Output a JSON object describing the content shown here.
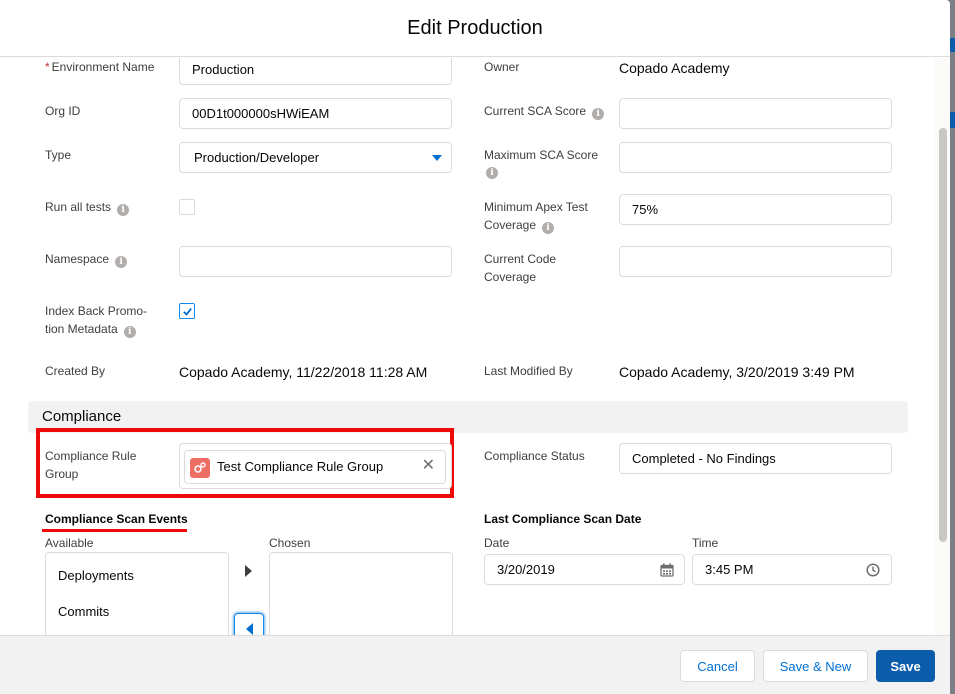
{
  "modal": {
    "title": "Edit Production"
  },
  "fields": {
    "environment_name": {
      "label": "Environment Name",
      "required_mark": "*",
      "value": "Production"
    },
    "owner": {
      "label": "Owner",
      "value": "Copado Academy"
    },
    "org_id": {
      "label": "Org ID",
      "value": "00D1t000000sHWiEAM"
    },
    "current_sca_score": {
      "label": "Current SCA Score",
      "value": ""
    },
    "type": {
      "label": "Type",
      "value": "Production/Developer"
    },
    "maximum_sca_score": {
      "label": "Maximum SCA Score",
      "value": ""
    },
    "run_all_tests": {
      "label": "Run all tests",
      "checked": false
    },
    "minimum_apex_test_coverage": {
      "label_line1": "Minimum Apex Test",
      "label_line2": "Coverage",
      "value": "75%"
    },
    "namespace": {
      "label": "Namespace",
      "value": ""
    },
    "current_code_coverage": {
      "label_line1": "Current Code",
      "label_line2": "Coverage",
      "value": ""
    },
    "index_back_promotion_metadata": {
      "label_line1": "Index Back Promo-",
      "label_line2": "tion Metadata",
      "checked": true
    },
    "created_by": {
      "label": "Created By",
      "value": "Copado Academy, 11/22/2018 11:28 AM"
    },
    "last_modified_by": {
      "label": "Last Modified By",
      "value": "Copado Academy, 3/20/2019 3:49 PM"
    }
  },
  "compliance": {
    "section_title": "Compliance",
    "rule_group": {
      "label_line1": "Compliance Rule",
      "label_line2": "Group",
      "pill_value": "Test Compliance Rule Group"
    },
    "status": {
      "label": "Compliance Status",
      "value": "Completed - No Findings"
    },
    "scan_events": {
      "heading": "Compliance Scan Events",
      "available_label": "Available",
      "chosen_label": "Chosen",
      "available_items": [
        "Deployments",
        "Commits"
      ]
    },
    "last_scan": {
      "heading": "Last Compliance Scan Date",
      "date_label": "Date",
      "date_value": "3/20/2019",
      "time_label": "Time",
      "time_value": "3:45 PM"
    }
  },
  "footer": {
    "cancel": "Cancel",
    "save_new": "Save & New",
    "save": "Save"
  },
  "colors": {
    "brand": "#0b5cab",
    "annotation": "#ef0a0a",
    "link": "#0070d2",
    "pill_icon": "#ef6e64"
  },
  "icons": {
    "info": "info-icon",
    "picklist": "chevron-down-icon",
    "calendar": "calendar-icon",
    "clock": "clock-icon",
    "remove": "close-icon",
    "record": "compliance-rule-group-icon"
  }
}
